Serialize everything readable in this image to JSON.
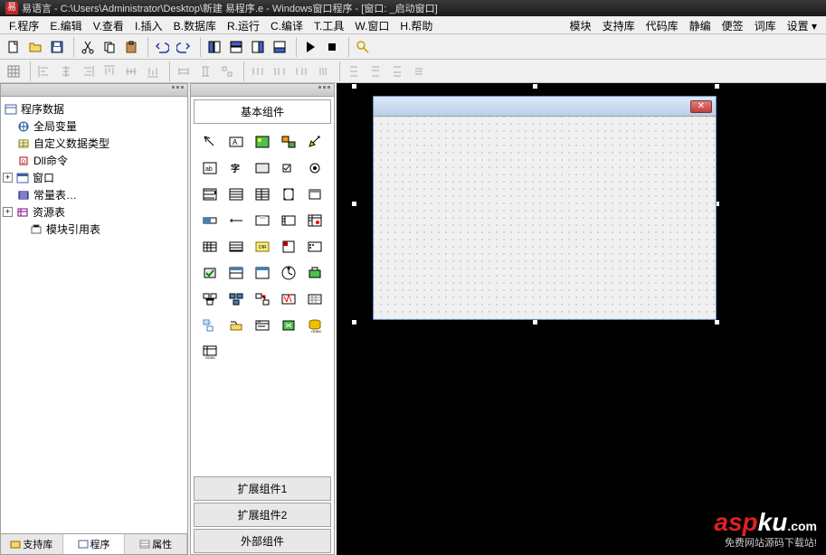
{
  "title": "易语言 - C:\\Users\\Administrator\\Desktop\\新建 易程序.e - Windows窗口程序 - [窗口: _启动窗口]",
  "app_badge": "易",
  "menu": {
    "file": "F.程序",
    "edit": "E.编辑",
    "view": "V.查看",
    "insert": "I.插入",
    "database": "B.数据库",
    "run": "R.运行",
    "compile": "C.编译",
    "tools": "T.工具",
    "window": "W.窗口",
    "help": "H.帮助",
    "module": "模块",
    "supportlib": "支持库",
    "codelib": "代码库",
    "staticcompile": "静编",
    "notes": "便签",
    "dictionary": "词库",
    "settings": "设置 ▾"
  },
  "tree": {
    "root": "程序数据",
    "nodes": [
      {
        "label": "全局变量",
        "indent": 14
      },
      {
        "label": "自定义数据类型",
        "indent": 14
      },
      {
        "label": "Dll命令",
        "indent": 14
      },
      {
        "label": "窗口",
        "indent": 14,
        "expander": "+"
      },
      {
        "label": "常量表…",
        "indent": 14
      },
      {
        "label": "资源表",
        "indent": 14,
        "expander": "+"
      },
      {
        "label": "模块引用表",
        "indent": 28
      }
    ]
  },
  "left_tabs": {
    "support": "支持库",
    "program": "程序",
    "property": "属性"
  },
  "component_tabs": {
    "basic": "基本组件",
    "ext1": "扩展组件1",
    "ext2": "扩展组件2",
    "external": "外部组件"
  },
  "watermark": {
    "brand_red": "asp",
    "brand_white": "ku",
    "brand_ext": ".com",
    "tagline": "免费网站源码下载站!"
  }
}
